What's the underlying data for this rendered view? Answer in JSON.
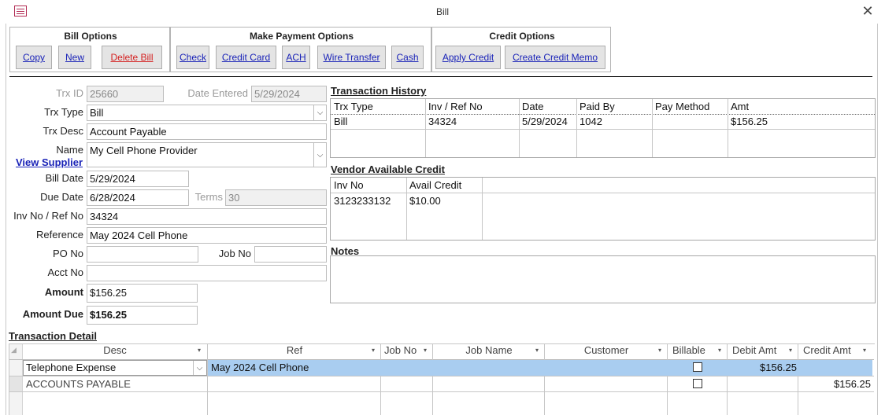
{
  "window": {
    "title": "Bill"
  },
  "bill_options": {
    "title": "Bill Options",
    "copy": "Copy",
    "new": "New",
    "delete": "Delete Bill"
  },
  "payment_options": {
    "title": "Make Payment Options",
    "check": "Check",
    "credit_card": "Credit Card",
    "ach": "ACH",
    "wire": "Wire Transfer",
    "cash": "Cash"
  },
  "credit_options": {
    "title": "Credit Options",
    "apply": "Apply Credit",
    "create_memo": "Create Credit Memo"
  },
  "form": {
    "trx_id": {
      "label": "Trx ID",
      "value": "25660"
    },
    "date_entered": {
      "label": "Date Entered",
      "value": "5/29/2024"
    },
    "trx_type": {
      "label": "Trx Type",
      "value": "Bill"
    },
    "trx_desc": {
      "label": "Trx Desc",
      "value": "Account Payable"
    },
    "name": {
      "label": "Name",
      "value": "My Cell Phone Provider"
    },
    "view_supplier": "View Supplier",
    "bill_date": {
      "label": "Bill Date",
      "value": "5/29/2024"
    },
    "due_date": {
      "label": "Due Date",
      "value": "6/28/2024"
    },
    "terms": {
      "label": "Terms",
      "value": "30"
    },
    "inv_no": {
      "label": "Inv No / Ref No",
      "value": "34324"
    },
    "reference": {
      "label": "Reference",
      "value": "May 2024 Cell Phone"
    },
    "po_no": {
      "label": "PO No",
      "value": ""
    },
    "job_no": {
      "label": "Job No",
      "value": ""
    },
    "acct_no": {
      "label": "Acct No",
      "value": ""
    },
    "amount": {
      "label": "Amount",
      "value": "$156.25"
    },
    "amount_due": {
      "label": "Amount Due",
      "value": "$156.25"
    }
  },
  "transaction_history": {
    "title": "Transaction History",
    "columns": [
      "Trx Type",
      "Inv / Ref No",
      "Date",
      "Paid By",
      "Pay Method",
      "Amt"
    ],
    "rows": [
      [
        "Bill",
        "34324",
        "5/29/2024",
        "1042",
        "",
        "$156.25"
      ]
    ]
  },
  "vendor_credit": {
    "title": "Vendor Available Credit",
    "columns": [
      "Inv No",
      "Avail Credit"
    ],
    "rows": [
      [
        "3123233132",
        "$10.00"
      ]
    ]
  },
  "notes": {
    "title": "Notes",
    "value": ""
  },
  "transaction_detail": {
    "title": "Transaction Detail",
    "columns": [
      "Desc",
      "Ref",
      "Job No",
      "Job Name",
      "Customer",
      "Billable",
      "Debit Amt",
      "Credit Amt"
    ],
    "rows": [
      {
        "desc": "Telephone Expense",
        "ref": "May 2024 Cell Phone",
        "job_no": "",
        "job_name": "",
        "customer": "",
        "billable": false,
        "debit": "$156.25",
        "credit": ""
      },
      {
        "desc": "ACCOUNTS PAYABLE",
        "ref": "",
        "job_no": "",
        "job_name": "",
        "customer": "",
        "billable": false,
        "debit": "",
        "credit": "$156.25"
      }
    ]
  },
  "colors": {
    "link": "#1a23b8",
    "danger": "#d42020",
    "selected_row": "#a9cdf0",
    "button_bg": "#e4e4e4"
  },
  "icons": [
    "app-form-icon",
    "close-icon",
    "dropdown-arrow-icon",
    "sort-arrow-icon",
    "checkbox"
  ]
}
